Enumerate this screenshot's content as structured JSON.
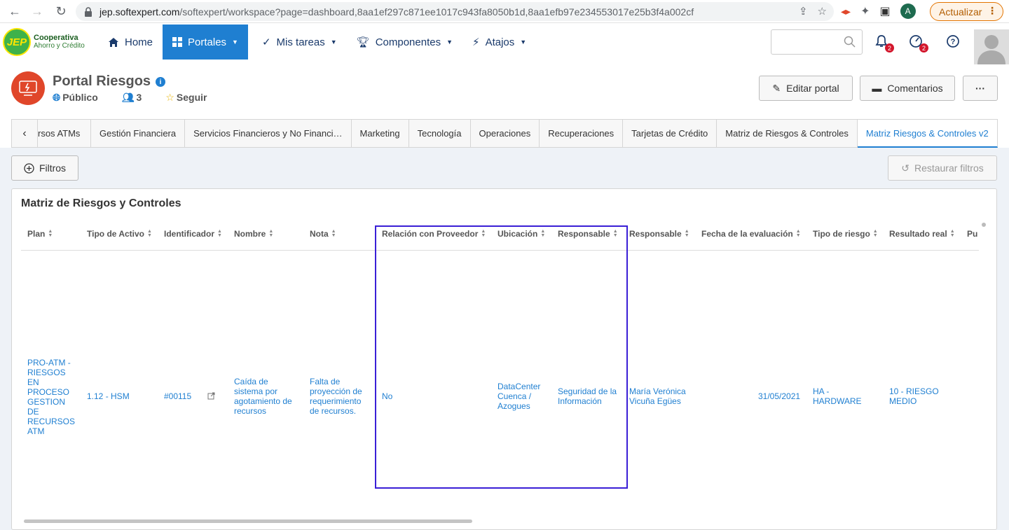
{
  "browser": {
    "url_host": "jep.softexpert.com",
    "url_path": "/softexpert/workspace?page=dashboard,8aa1ef297c871ee1017c943fa8050b1d,8aa1efb97e234553017e25b3f4a002cf",
    "profile_initial": "A",
    "update_label": "Actualizar"
  },
  "logo": {
    "mark": "JEP",
    "line1": "Cooperativa",
    "line2": "Ahorro y Crédito"
  },
  "nav": {
    "home": "Home",
    "portales": "Portales",
    "tareas": "Mis tareas",
    "componentes": "Componentes",
    "atajos": "Atajos"
  },
  "header": {
    "notif_count": "2",
    "tasks_count": "2"
  },
  "portal": {
    "title": "Portal Riesgos",
    "visibility": "Público",
    "members": "3",
    "follow": "Seguir",
    "edit_label": "Editar portal",
    "comments_label": "Comentarios",
    "more_label": "···"
  },
  "tabs": [
    "rsos ATMs",
    "Gestión Financiera",
    "Servicios Financieros y No Financi…",
    "Marketing",
    "Tecnología",
    "Operaciones",
    "Recuperaciones",
    "Tarjetas de Crédito",
    "Matriz de Riesgos & Controles",
    "Matriz Riesgos & Controles v2"
  ],
  "filters": {
    "filter_label": "Filtros",
    "restore_label": "Restaurar filtros"
  },
  "panel": {
    "title": "Matriz de Riesgos y Controles",
    "columns": [
      "Plan",
      "Tipo de Activo",
      "Identificador",
      "Nombre",
      "Nota",
      "Relación con Proveedor",
      "Ubicación",
      "Responsable",
      "Responsable",
      "Fecha de la evaluación",
      "Tipo de riesgo",
      "Resultado real",
      "Pu"
    ],
    "row": {
      "plan": "PRO-ATM - RIESGOS EN PROCESO GESTION DE RECURSOS ATM",
      "tipo_activo": "1.12 - HSM",
      "identificador": "#00115",
      "nombre": "Caída de sistema por agotamiento de recursos",
      "nota": "Falta de proyección de requerimiento de recursos.",
      "proveedor": "No",
      "ubicacion": "DataCenter Cuenca / Azogues",
      "responsable1": "Seguridad de la Información",
      "responsable2": "María Verónica Vicuña Egües",
      "fecha": "31/05/2021",
      "tipo_riesgo": "HA - HARDWARE",
      "resultado": "10 - RIESGO MEDIO"
    }
  }
}
